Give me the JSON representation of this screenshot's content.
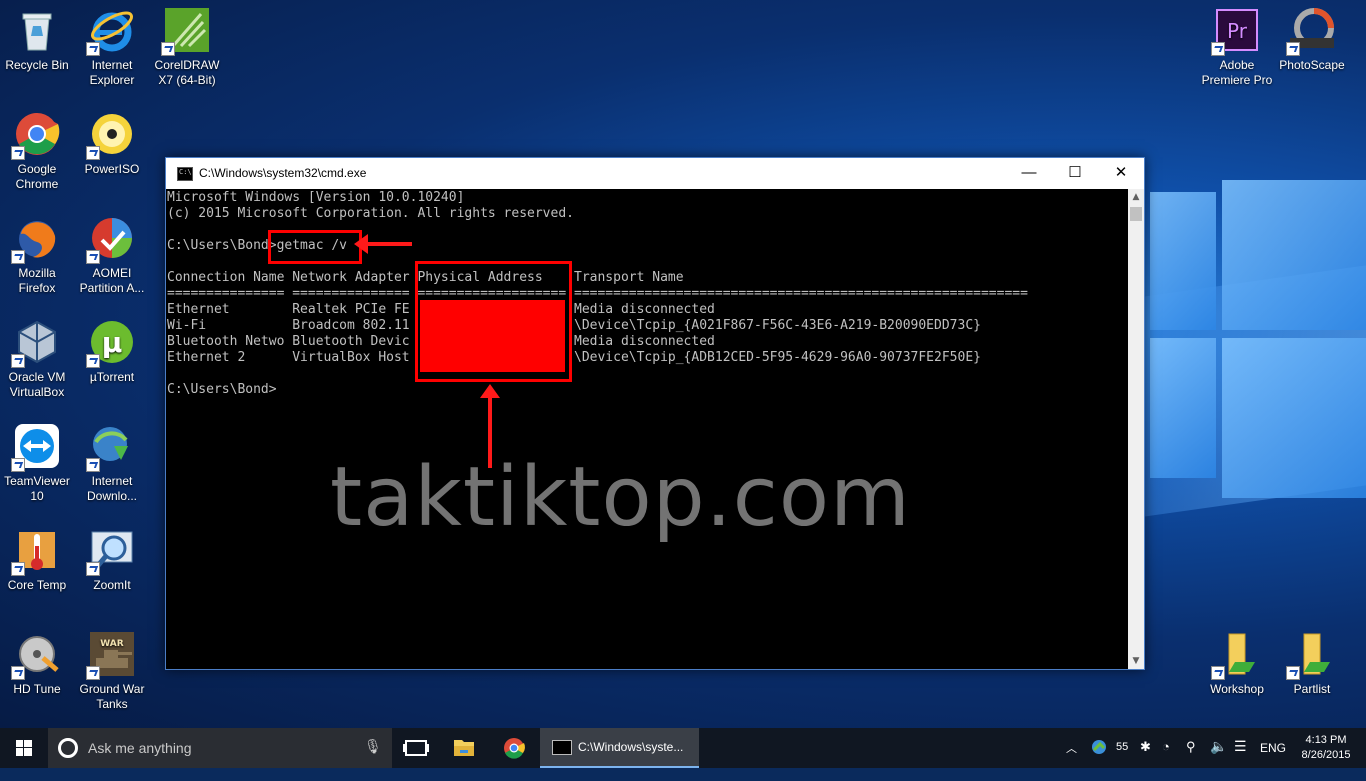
{
  "desktop": {
    "icons_left": [
      {
        "label": "Recycle Bin",
        "icon": "recycle-bin-icon"
      },
      {
        "label": "Internet Explorer",
        "icon": "internet-explorer-icon"
      },
      {
        "label": "CorelDRAW X7 (64-Bit)",
        "icon": "coreldraw-icon"
      },
      {
        "label": "Google Chrome",
        "icon": "chrome-icon"
      },
      {
        "label": "PowerISO",
        "icon": "poweriso-icon"
      },
      {
        "label": "Mozilla Firefox",
        "icon": "firefox-icon"
      },
      {
        "label": "AOMEI Partition A...",
        "icon": "aomei-icon"
      },
      {
        "label": "Oracle VM VirtualBox",
        "icon": "virtualbox-icon"
      },
      {
        "label": "µTorrent",
        "icon": "utorrent-icon"
      },
      {
        "label": "TeamViewer 10",
        "icon": "teamviewer-icon"
      },
      {
        "label": "Internet Downlo...",
        "icon": "idm-icon"
      },
      {
        "label": "Core Temp",
        "icon": "core-temp-icon"
      },
      {
        "label": "ZoomIt",
        "icon": "zoomit-icon"
      },
      {
        "label": "HD Tune",
        "icon": "hd-tune-icon"
      },
      {
        "label": "Ground War Tanks",
        "icon": "ground-war-icon"
      }
    ],
    "icons_right": [
      {
        "label": "Adobe Premiere Pro",
        "icon": "premiere-icon"
      },
      {
        "label": "PhotoScape",
        "icon": "photoscape-icon"
      },
      {
        "label": "Workshop",
        "icon": "folder-icon"
      },
      {
        "label": "Partlist",
        "icon": "folder-icon"
      }
    ]
  },
  "cmd": {
    "title": "C:\\Windows\\system32\\cmd.exe",
    "lines": [
      "Microsoft Windows [Version 10.0.10240]",
      "(c) 2015 Microsoft Corporation. All rights reserved.",
      "",
      "C:\\Users\\Bond>getmac /v",
      "",
      "Connection Name Network Adapter Physical Address    Transport Name",
      "=============== =============== =================== ==========================================================",
      "Ethernet        Realtek PCIe FE                     Media disconnected",
      "Wi-Fi           Broadcom 802.11                     \\Device\\Tcpip_{A021F867-F56C-43E6-A219-B20090EDD73C}",
      "Bluetooth Netwo Bluetooth Devic                     Media disconnected",
      "Ethernet 2      VirtualBox Host                     \\Device\\Tcpip_{ADB12CED-5F95-4629-96A0-90737FE2F50E}",
      "",
      "C:\\Users\\Bond>"
    ]
  },
  "watermark": "taktiktop.com",
  "taskbar": {
    "search_placeholder": "Ask me anything",
    "active_window": "C:\\Windows\\syste...",
    "network_count": "55",
    "language": "ENG",
    "time": "4:13 PM",
    "date": "8/26/2015"
  }
}
